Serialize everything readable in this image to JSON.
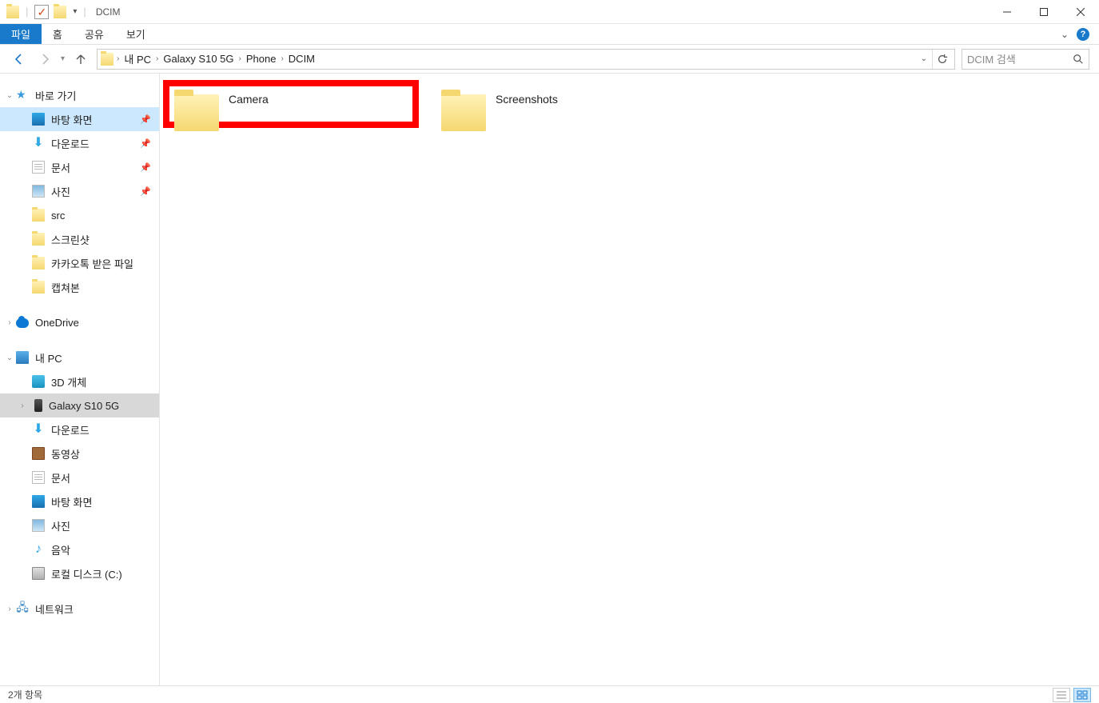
{
  "window": {
    "title": "DCIM"
  },
  "ribbon": {
    "file": "파일",
    "home": "홈",
    "share": "공유",
    "view": "보기"
  },
  "breadcrumb": [
    "내 PC",
    "Galaxy S10 5G",
    "Phone",
    "DCIM"
  ],
  "search": {
    "placeholder": "DCIM 검색"
  },
  "sidebar": {
    "quick_access": "바로 가기",
    "quick_items": [
      {
        "label": "바탕 화면",
        "icon": "desktop",
        "pinned": true,
        "highlight": true
      },
      {
        "label": "다운로드",
        "icon": "download",
        "pinned": true
      },
      {
        "label": "문서",
        "icon": "doc",
        "pinned": true
      },
      {
        "label": "사진",
        "icon": "pic",
        "pinned": true
      },
      {
        "label": "src",
        "icon": "folder"
      },
      {
        "label": "스크린샷",
        "icon": "folder"
      },
      {
        "label": "카카오톡 받은 파일",
        "icon": "folder"
      },
      {
        "label": "캡쳐본",
        "icon": "folder"
      }
    ],
    "onedrive": "OneDrive",
    "this_pc": "내 PC",
    "pc_items": [
      {
        "label": "3D 개체",
        "icon": "3d"
      },
      {
        "label": "Galaxy S10 5G",
        "icon": "phone",
        "selected": true
      },
      {
        "label": "다운로드",
        "icon": "download"
      },
      {
        "label": "동영상",
        "icon": "video"
      },
      {
        "label": "문서",
        "icon": "doc"
      },
      {
        "label": "바탕 화면",
        "icon": "desktop"
      },
      {
        "label": "사진",
        "icon": "pic"
      },
      {
        "label": "음악",
        "icon": "music"
      },
      {
        "label": "로컬 디스크 (C:)",
        "icon": "disk"
      }
    ],
    "network": "네트워크"
  },
  "folders": [
    {
      "name": "Camera",
      "highlighted": true
    },
    {
      "name": "Screenshots",
      "highlighted": false
    }
  ],
  "status": {
    "count_text": "2개 항목"
  }
}
